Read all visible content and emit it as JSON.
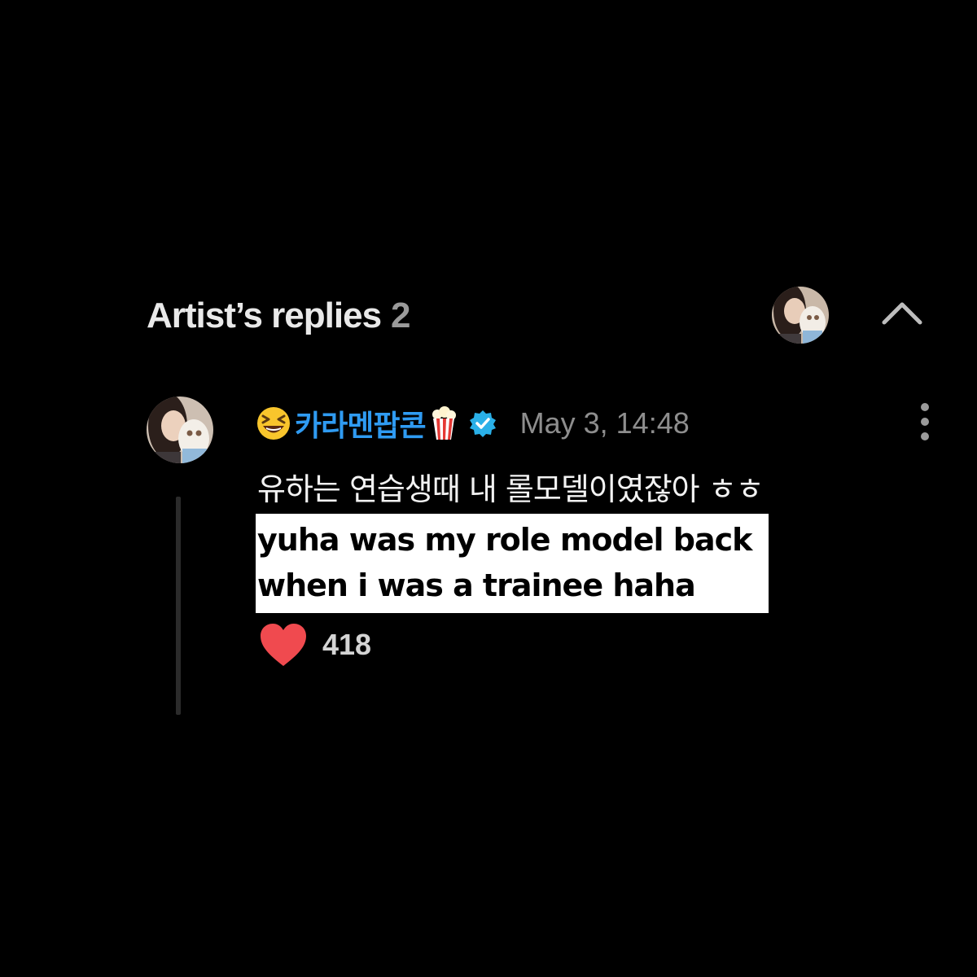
{
  "section": {
    "title": "Artist’s replies",
    "count": "2"
  },
  "comment": {
    "author": "카라멘팝콘",
    "author_prefix_icon": "laughing-emoji-icon",
    "author_suffix_icon": "popcorn-icon",
    "verified_icon": "verified-badge-icon",
    "timestamp": "May 3, 14:48",
    "text": "유하는 연습생때 내 롤모델이였잖아 ㅎㅎ",
    "translation_lines": [
      "yuha was my role model back",
      "when i was a trainee haha"
    ],
    "likes": "418"
  },
  "colors": {
    "background": "#000000",
    "author": "#2f9bf2",
    "heart": "#f04a4f",
    "verified": "#2ab0e8",
    "timestamp": "#8e8e8e"
  }
}
